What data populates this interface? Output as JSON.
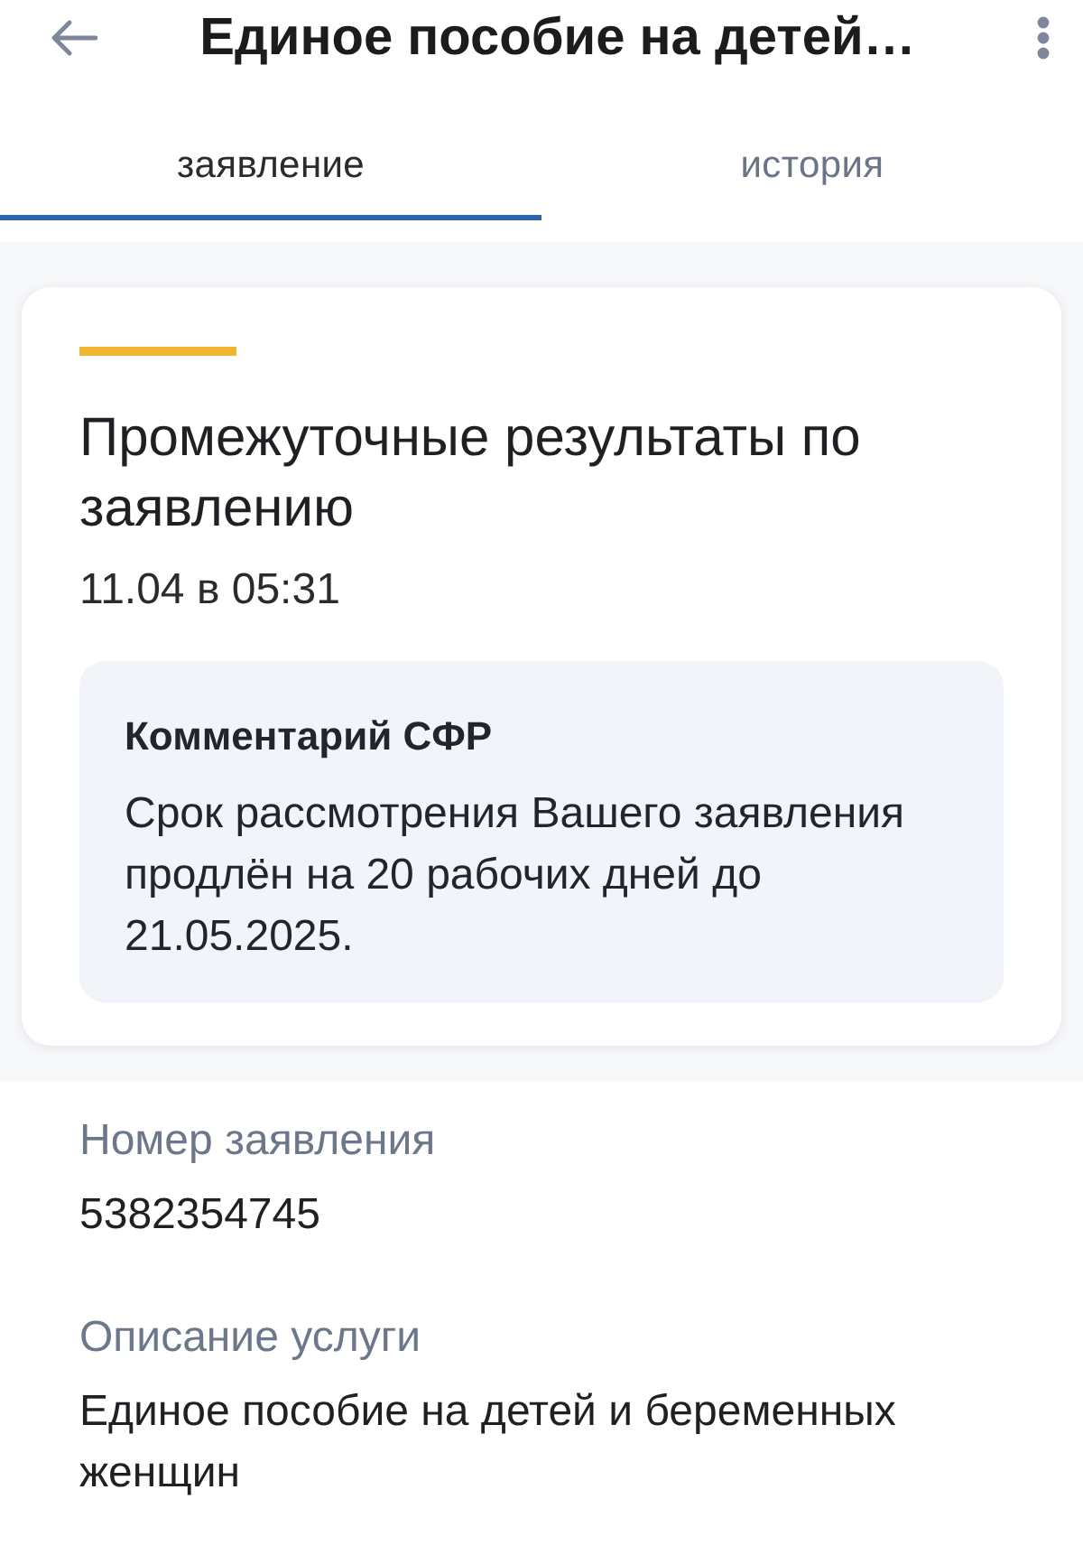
{
  "header": {
    "title": "Единое пособие на детей…"
  },
  "tabs": [
    {
      "label": "заявление",
      "selected": true
    },
    {
      "label": "история",
      "selected": false
    }
  ],
  "status_card": {
    "title": "Промежуточные результаты по заявлению",
    "datetime": "11.04 в 05:31",
    "comment": {
      "title": "Комментарий СФР",
      "text": "Срок рассмотрения Вашего заявления продлён на 20 рабочих дней до 21.05.2025."
    }
  },
  "fields": [
    {
      "label": "Номер заявления",
      "value": "5382354745"
    },
    {
      "label": "Описание услуги",
      "value": "Единое пособие на детей и беременных женщин"
    }
  ]
}
